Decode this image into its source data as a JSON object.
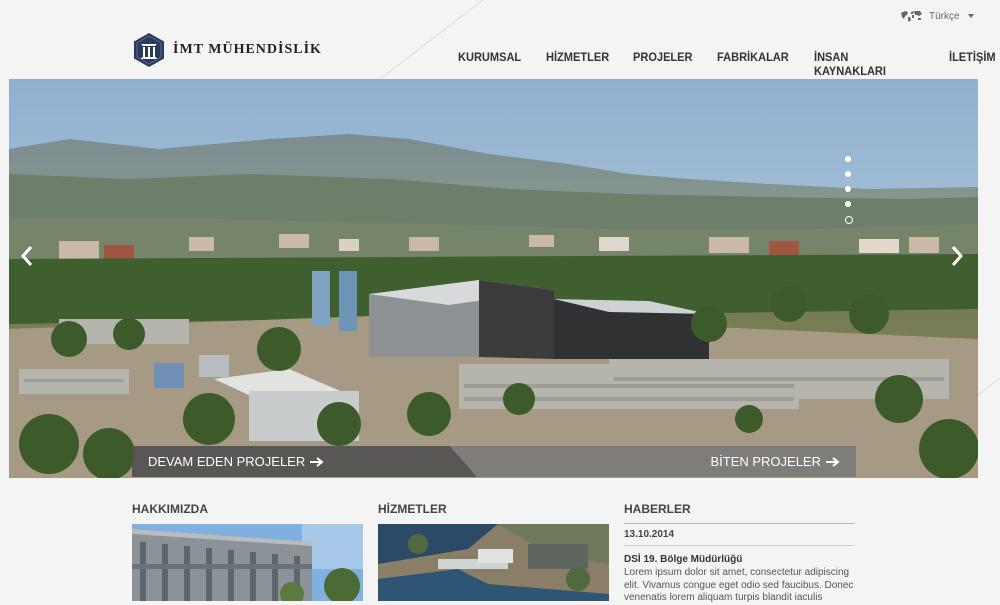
{
  "header": {
    "language_label": "Türkçe",
    "logo_text": "İMT MÜHENDİSLİK",
    "nav": [
      "KURUMSAL",
      "HİZMETLER",
      "PROJELER",
      "FABRİKALAR",
      "İNSAN KAYNAKLARI",
      "İLETİŞİM"
    ]
  },
  "hero": {
    "slides_total": 5,
    "active_slide_index": 4,
    "ongoing_projects_label": "DEVAM EDEN PROJELER",
    "completed_projects_label": "BİTEN PROJELER"
  },
  "sections": {
    "about_title": "HAKKIMIZDA",
    "services_title": "HİZMETLER",
    "news_title": "HABERLER"
  },
  "news": {
    "date": "13.10.2014",
    "headline": "DSİ 19. Bölge Müdürlüğü",
    "body": "Lorem ipsum dolor sit amet, consectetur adipiscing elit. Vivamus congue eget odio sed faucibus. Donec venenatis lorem aliquam turpis blandit iaculis"
  },
  "colors": {
    "logo_navy": "#2b3a5c",
    "nav_text": "#333333",
    "bar_dark": "#505050",
    "bar_light": "#787878"
  }
}
